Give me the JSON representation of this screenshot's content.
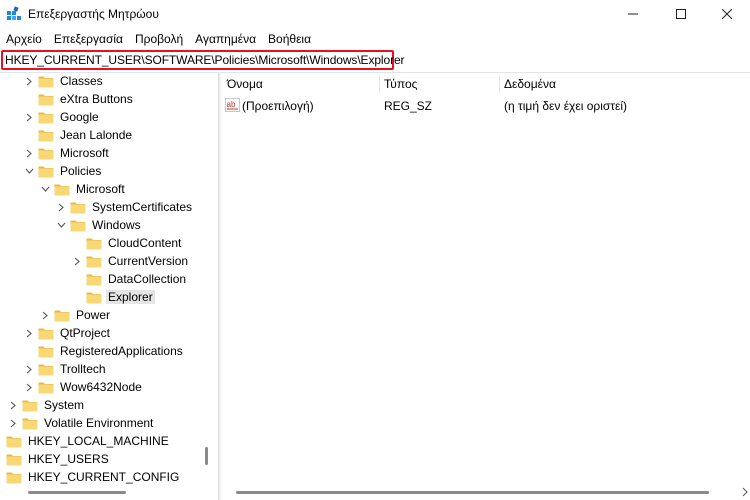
{
  "window": {
    "title": "Επεξεργαστής Μητρώου",
    "controls": [
      "minimize",
      "maximize",
      "close"
    ]
  },
  "menu": [
    "Αρχείο",
    "Επεξεργασία",
    "Προβολή",
    "Αγαπημένα",
    "Βοήθεια"
  ],
  "address": {
    "path": "HKEY_CURRENT_USER\\SOFTWARE\\Policies\\Microsoft\\Windows\\Explorer",
    "highlight_color": "#e81123"
  },
  "tree": {
    "items": [
      {
        "label": "Classes",
        "chevron": "right"
      },
      {
        "label": "eXtra Buttons",
        "chevron": "none"
      },
      {
        "label": "Google",
        "chevron": "right"
      },
      {
        "label": "Jean Lalonde",
        "chevron": "none"
      },
      {
        "label": "Microsoft",
        "chevron": "right"
      },
      {
        "label": "Policies",
        "chevron": "down"
      },
      {
        "label": "Microsoft",
        "chevron": "down"
      },
      {
        "label": "SystemCertificates",
        "chevron": "right"
      },
      {
        "label": "Windows",
        "chevron": "down"
      },
      {
        "label": "CloudContent",
        "chevron": "none"
      },
      {
        "label": "CurrentVersion",
        "chevron": "right"
      },
      {
        "label": "DataCollection",
        "chevron": "none"
      },
      {
        "label": "Explorer",
        "chevron": "none",
        "selected": true
      },
      {
        "label": "Power",
        "chevron": "right"
      },
      {
        "label": "QtProject",
        "chevron": "right"
      },
      {
        "label": "RegisteredApplications",
        "chevron": "none"
      },
      {
        "label": "Trolltech",
        "chevron": "right"
      },
      {
        "label": "Wow6432Node",
        "chevron": "right"
      },
      {
        "label": "System",
        "chevron": "right"
      },
      {
        "label": "Volatile Environment",
        "chevron": "right"
      },
      {
        "label": "HKEY_LOCAL_MACHINE",
        "chevron": "right"
      },
      {
        "label": "HKEY_USERS",
        "chevron": "right"
      },
      {
        "label": "HKEY_CURRENT_CONFIG",
        "chevron": "right"
      }
    ]
  },
  "values": {
    "headers": {
      "name": "Όνομα",
      "type": "Τύπος",
      "data": "Δεδομένα"
    },
    "rows": [
      {
        "icon": "string-value-icon",
        "name": "(Προεπιλογή)",
        "type": "REG_SZ",
        "data": "(η τιμή δεν έχει οριστεί)"
      }
    ]
  },
  "colors": {
    "folder": "#f8d775",
    "folder_shade": "#e8b84a",
    "selection": "#e5e5e5",
    "highlight_border": "#e81123"
  }
}
